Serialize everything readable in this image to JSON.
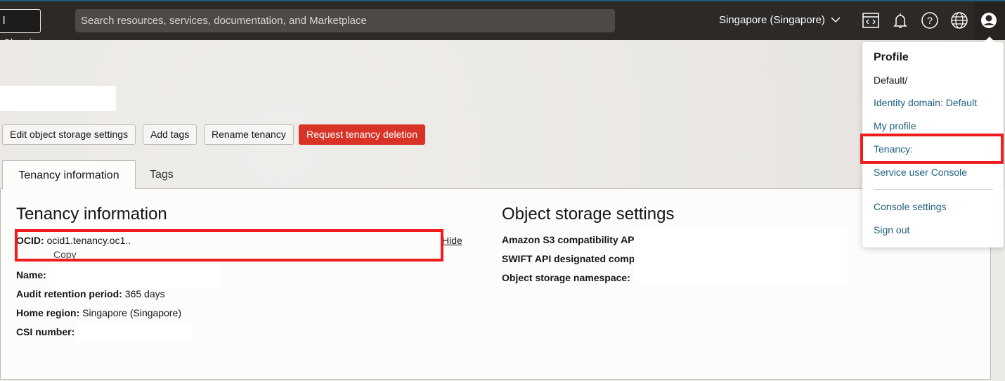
{
  "topbar": {
    "classic_label": "l Classic",
    "search_placeholder": "Search resources, services, documentation, and Marketplace",
    "region": "Singapore (Singapore)"
  },
  "actions": {
    "edit": "Edit object storage settings",
    "add_tags": "Add tags",
    "rename": "Rename tenancy",
    "delete": "Request tenancy deletion",
    "delete_color": "#d93328"
  },
  "tabs": [
    {
      "label": "Tenancy information"
    },
    {
      "label": "Tags"
    }
  ],
  "tenancy": {
    "title": "Tenancy information",
    "ocid_label": "OCID:",
    "ocid_value": "ocid1.tenancy.oc1..",
    "hide": "Hide",
    "copy": "Copy",
    "name_label": "Name:",
    "audit_label": "Audit retention period:",
    "audit_value": "365 days",
    "home_label": "Home region:",
    "home_value": "Singapore (Singapore)",
    "csi_label": "CSI number:"
  },
  "storage": {
    "title": "Object storage settings",
    "s3_label": "Amazon S3 compatibility AP",
    "swift_label": "SWIFT API designated comp",
    "ns_label": "Object storage namespace:"
  },
  "profile_menu": {
    "title": "Profile",
    "user": "Default/",
    "identity_domain": "Identity domain: Default",
    "my_profile": "My profile",
    "tenancy": "Tenancy:",
    "service_console": "Service user Console",
    "console_settings": "Console settings",
    "sign_out": "Sign out"
  }
}
